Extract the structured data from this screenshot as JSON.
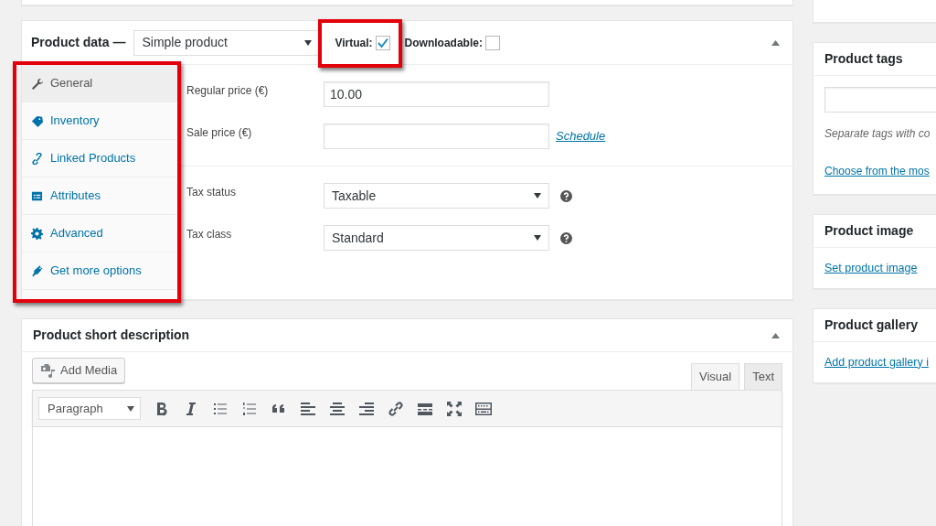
{
  "product_data": {
    "title": "Product data —",
    "product_type": "Simple product",
    "expanded": true,
    "tabs_highlighted": true,
    "options": [
      {
        "label": "Virtual:",
        "checked": true,
        "highlighted": true
      },
      {
        "label": "Downloadable:",
        "checked": false,
        "highlighted": false
      }
    ],
    "tabs": [
      {
        "label": "General",
        "selected": true
      },
      {
        "label": "Inventory",
        "selected": false
      },
      {
        "label": "Linked Products",
        "selected": false
      },
      {
        "label": "Attributes",
        "selected": false
      },
      {
        "label": "Advanced",
        "selected": false
      },
      {
        "label": "Get more options",
        "selected": false
      }
    ],
    "field_groups": [
      [
        {
          "label": "Regular price (€)",
          "kind": "text",
          "value": "10.00"
        },
        {
          "label": "Sale price (€)",
          "kind": "text",
          "link": "Schedule"
        }
      ],
      [
        {
          "label": "Tax status",
          "kind": "select",
          "value": "Taxable",
          "help": true
        },
        {
          "label": "Tax class",
          "kind": "select",
          "value": "Standard",
          "help": true
        }
      ]
    ]
  },
  "short_description": {
    "title": "Product short description",
    "expanded": true,
    "add_media": "Add Media",
    "format": "Paragraph",
    "editor_tabs": [
      {
        "label": "Visual",
        "selected": true
      },
      {
        "label": "Text",
        "selected": false
      }
    ]
  },
  "sidebar": [
    {
      "title": "Product tags",
      "kind": "tags",
      "hint": "Separate tags with co",
      "link": "Choose from the mos"
    },
    {
      "title": "Product image",
      "kind": "link",
      "link": "Set product image"
    },
    {
      "title": "Product gallery",
      "kind": "link",
      "link": "Add product gallery i"
    }
  ]
}
